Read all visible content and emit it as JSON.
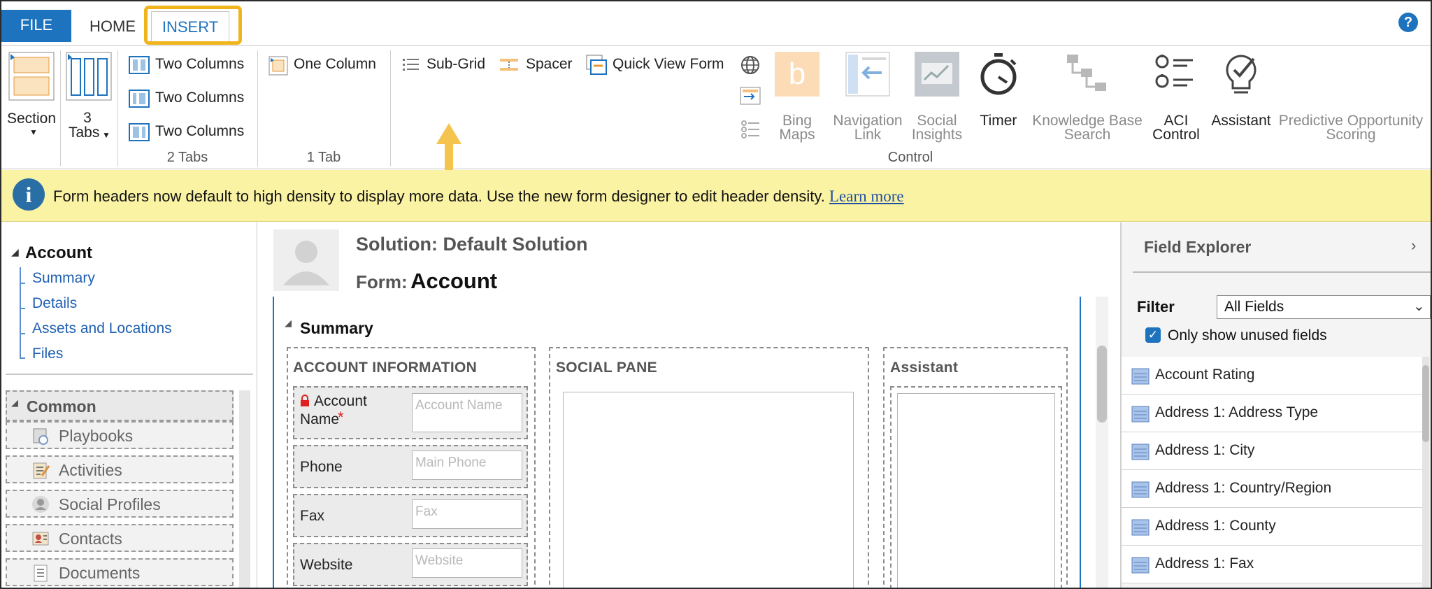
{
  "tabs": {
    "file": "FILE",
    "home": "HOME",
    "insert": "INSERT",
    "help": "?"
  },
  "ribbon": {
    "section": "Section",
    "tabs_count": "3",
    "tabs_label": "Tabs",
    "two_columns_1": "Two Columns",
    "two_columns_2": "Two Columns",
    "two_columns_3": "Two Columns",
    "group_2tabs": "2 Tabs",
    "one_column": "One Column",
    "group_1tab": "1 Tab",
    "sub_grid": "Sub-Grid",
    "spacer": "Spacer",
    "quick_view_form": "Quick View Form",
    "bing_maps_1": "Bing",
    "bing_maps_2": "Maps",
    "navigation_link_1": "Navigation",
    "navigation_link_2": "Link",
    "social_insights_1": "Social",
    "social_insights_2": "Insights",
    "timer": "Timer",
    "knowledge_base_search_1": "Knowledge Base",
    "knowledge_base_search_2": "Search",
    "aci_control_1": "ACI",
    "aci_control_2": "Control",
    "assistant": "Assistant",
    "predictive_1": "Predictive Opportunity",
    "predictive_2": "Scoring",
    "group_control": "Control"
  },
  "banner": {
    "icon": "i",
    "text": "Form headers now default to high density to display more data. Use the new form designer to edit header density.",
    "link": "Learn more"
  },
  "nav": {
    "account": "Account",
    "items": [
      "Summary",
      "Details",
      "Assets and Locations",
      "Files"
    ],
    "common": "Common",
    "common_items": [
      "Playbooks",
      "Activities",
      "Social Profiles",
      "Contacts",
      "Documents"
    ]
  },
  "form": {
    "solution": "Solution: Default Solution",
    "form_label": "Form:",
    "form_name": "Account",
    "section_title": "Summary",
    "account_info": "ACCOUNT INFORMATION",
    "social_pane": "SOCIAL PANE",
    "assistant": "Assistant",
    "fields": [
      {
        "label1": "Account",
        "label2": "Name",
        "required": "*",
        "placeholder": "Account Name"
      },
      {
        "label1": "Phone",
        "placeholder": "Main Phone"
      },
      {
        "label1": "Fax",
        "placeholder": "Fax"
      },
      {
        "label1": "Website",
        "placeholder": "Website"
      }
    ]
  },
  "field_explorer": {
    "title": "Field Explorer",
    "filter_label": "Filter",
    "filter_value": "All Fields",
    "only_unused": "Only show unused fields",
    "only_unused_checked": true,
    "items": [
      "Account Rating",
      "Address 1: Address Type",
      "Address 1: City",
      "Address 1: Country/Region",
      "Address 1: County",
      "Address 1: Fax"
    ]
  },
  "colors": {
    "accent": "#1e73be",
    "highlight": "#f0b41c",
    "banner": "#fbf3a4"
  }
}
